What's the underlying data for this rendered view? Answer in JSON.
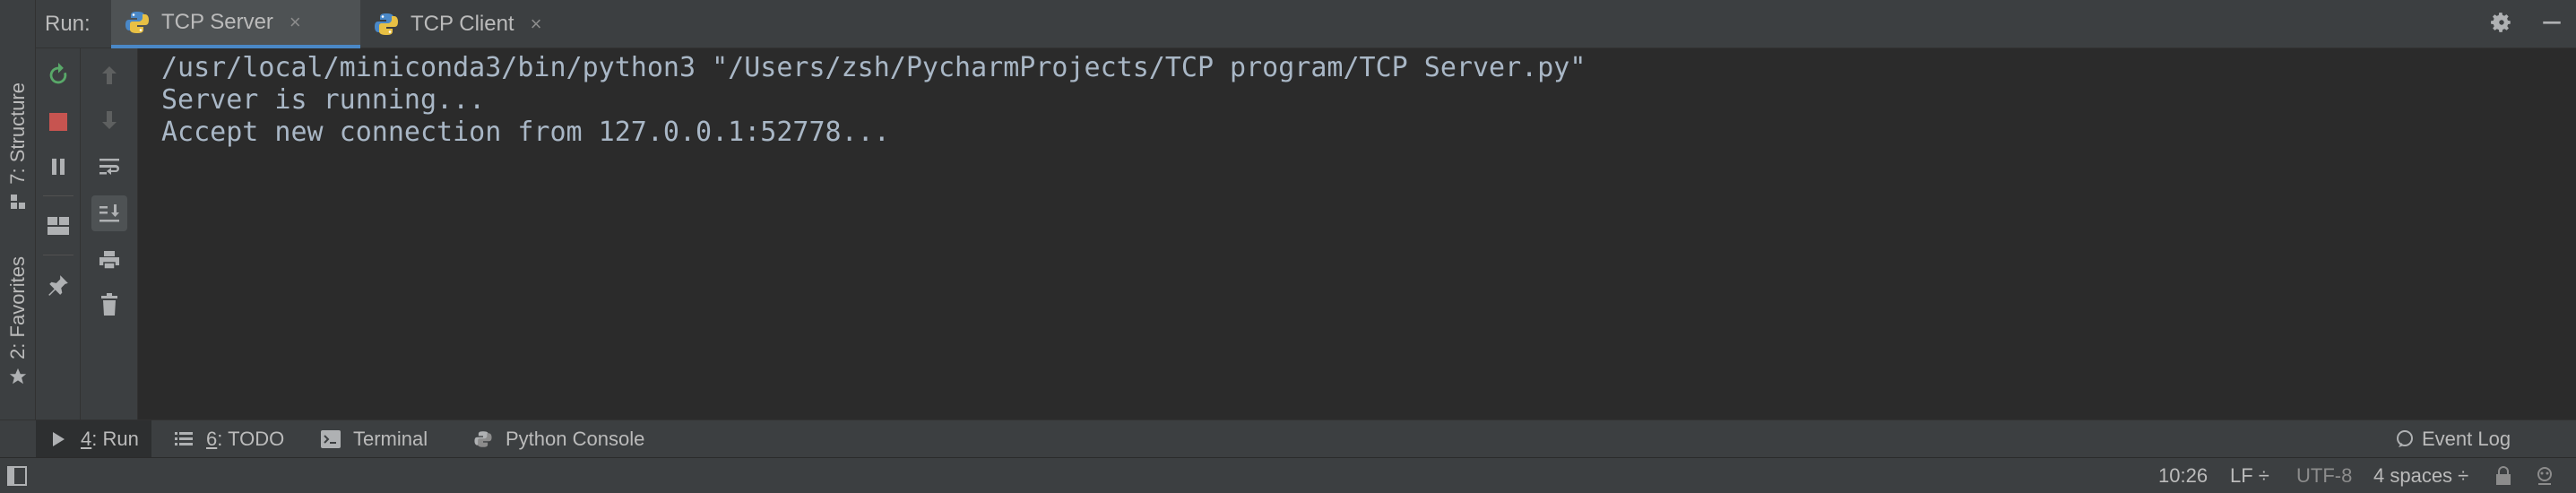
{
  "left_stripe": {
    "structure_label": "7: Structure",
    "favorites_label": "2: Favorites"
  },
  "run_window": {
    "label": "Run:",
    "tabs": [
      {
        "label": "TCP Server",
        "active": true
      },
      {
        "label": "TCP Client",
        "active": false
      }
    ],
    "close_glyph": "×"
  },
  "console": {
    "lines": [
      "/usr/local/miniconda3/bin/python3 \"/Users/zsh/PycharmProjects/TCP program/TCP Server.py\"",
      "Server is running...",
      "Accept new connection from 127.0.0.1:52778..."
    ]
  },
  "bottom_toolbar": {
    "run": {
      "mnemonic": "4",
      "rest": ": Run"
    },
    "todo": {
      "mnemonic": "6",
      "rest": ": TODO"
    },
    "terminal": "Terminal",
    "python_console": "Python Console",
    "event_log": "Event Log"
  },
  "status_bar": {
    "position": "10:26",
    "line_separator": "LF ÷",
    "encoding": "UTF-8",
    "indent": "4 spaces ÷"
  },
  "colors": {
    "background": "#2b2b2b",
    "panel": "#3c3f41",
    "accent": "#4a88c7",
    "rerun_green": "#59a869",
    "stop_red": "#c75450",
    "console_text": "#a9b7c6"
  }
}
